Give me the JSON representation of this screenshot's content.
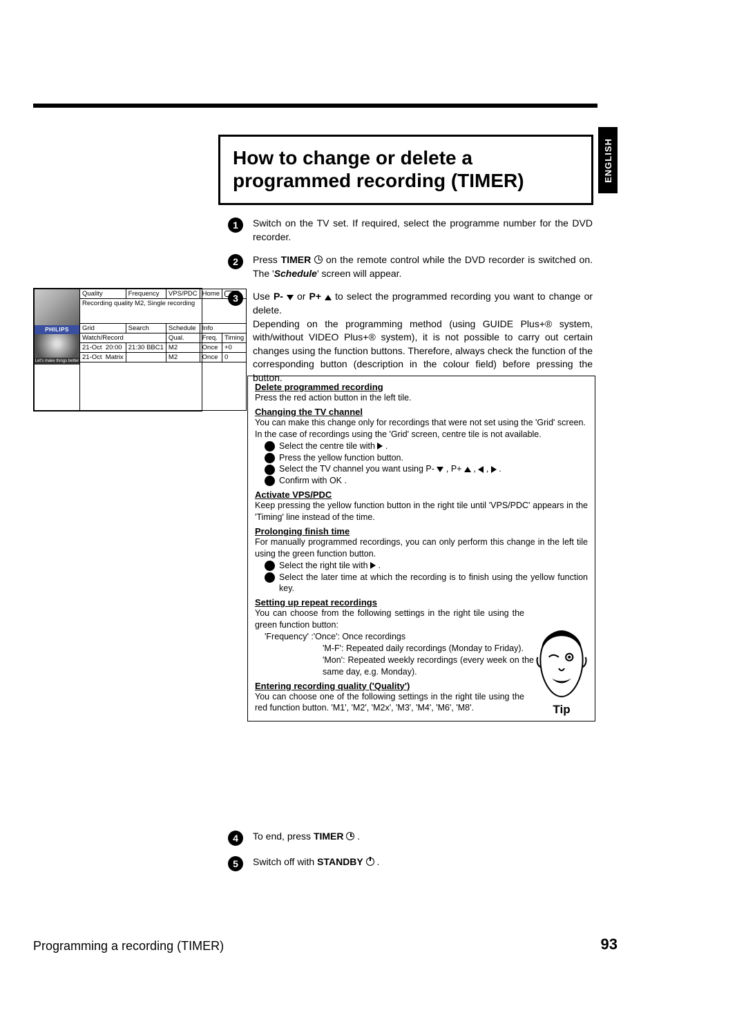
{
  "language_tab": "ENGLISH",
  "title": "How to change or delete a programmed recording (TIMER)",
  "steps": {
    "s1": "Switch on the TV set. If required, select the programme number for the DVD recorder.",
    "s2a": "Press ",
    "s2b": "TIMER",
    "s2c": " on the remote control while the DVD recorder is switched on. The '",
    "s2d": "Schedule",
    "s2e": "' screen will appear.",
    "s3a": "Use ",
    "s3b": "P-",
    "s3c": " or ",
    "s3d": "P+",
    "s3e": " to select the programmed recording you want to change or delete.",
    "s3f": "Depending on the programming method (using GUIDE Plus+® system, with/without VIDEO Plus+® system), it is not possible to carry out certain changes using the function buttons. Therefore, always check the function of the corresponding button (description in the colour field) before pressing the button.",
    "s4a": "To end, press ",
    "s4b": "TIMER",
    "s4c": " .",
    "s5a": "Switch off with ",
    "s5b": "STANDBY",
    "s5c": " ."
  },
  "tip": {
    "h1": "Delete programmed recording",
    "p1": "Press the red action button in the left tile.",
    "h2": "Changing the TV channel",
    "p2a": "You can make this change only for recordings that were not set using the '",
    "p2b": "Grid",
    "p2c": "' screen.",
    "p2d": "In the case of recordings using the '",
    "p2e": "Grid",
    "p2f": "' screen, centre tile is not available.",
    "c1": "Select the centre tile with ",
    "c2": "Press the yellow function button.",
    "c3a": "Select the TV channel you want using ",
    "c3b": "P-",
    "c3c": "P+",
    "c4a": "Confirm with ",
    "c4b": "OK",
    "h3": "Activate VPS/PDC",
    "p3a": "Keep pressing the yellow function button in the right tile until 'VPS/PDC' appears in the '",
    "p3b": "Timing",
    "p3c": "' line instead of the time.",
    "h4": "Prolonging finish time",
    "p4": "For manually programmed recordings, you can only perform this change in the left tile using the green function button.",
    "d1": "Select the right tile with ",
    "d2": "Select the later time at which the recording is to finish using the yellow function key.",
    "h5": "Setting up repeat recordings",
    "p5": "You can choose from the following settings in the right tile using the green function button:",
    "freq_label": "Frequency",
    "freq_once_k": "Once",
    "freq_once_v": ": Once recordings",
    "freq_mf_k": "M-F",
    "freq_mf_v": ": Repeated daily recordings (Monday to Friday).",
    "freq_mon_k": "Mon",
    "freq_mon_v": ": Repeated weekly recordings (every week on the same day, e.g. Monday).",
    "h6": "Entering recording quality ('Quality')",
    "p6a": "You can choose one of the following settings in the right tile using the red function button. ",
    "p6b": "M1",
    "p6c": "M2",
    "p6d": "M2x",
    "p6e": "M3",
    "p6f": "M4",
    "p6g": "M6",
    "p6h": "M8",
    "tip_label": "Tip"
  },
  "mini": {
    "hdr": [
      "Quality",
      "Frequency",
      "VPS/PDC",
      "Home"
    ],
    "subhdr": "Recording quality M2, Single recording",
    "row2": [
      "Grid",
      "Search",
      "Schedule",
      "Info"
    ],
    "row3l": "Watch/Record",
    "row3r": [
      "Qual.",
      "Freq.",
      "Timing"
    ],
    "r1": [
      "21-Oct",
      "20:00",
      "21:30",
      "BBC1",
      "M2",
      "Once",
      "+0"
    ],
    "r2": [
      "21-Oct",
      "Matrix",
      "",
      "",
      "M2",
      "Once",
      "0"
    ],
    "philips": "PHILIPS",
    "slogan": "Let's make things better"
  },
  "footer": {
    "left": "Programming a recording (TIMER)",
    "right": "93"
  }
}
